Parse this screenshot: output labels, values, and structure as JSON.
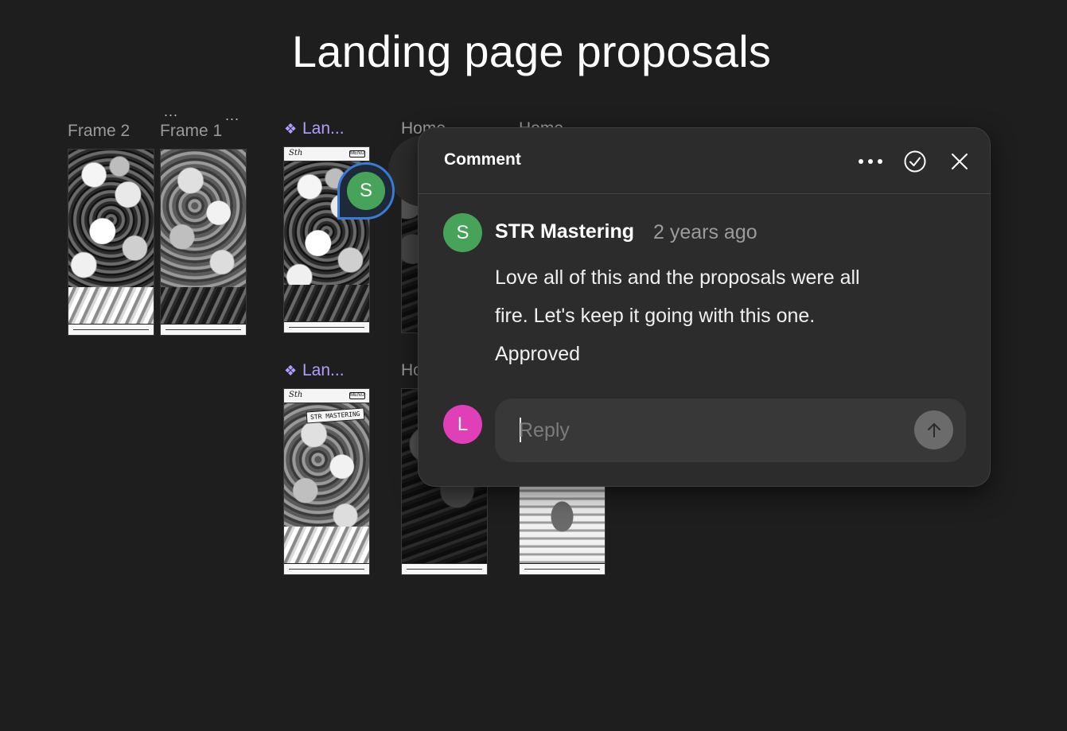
{
  "page": {
    "title": "Landing page proposals"
  },
  "frames": {
    "row1": [
      {
        "label": "Frame 2",
        "component": false
      },
      {
        "label": "Frame 1",
        "component": false
      },
      {
        "label": "Lan...",
        "component": true
      },
      {
        "label": "Home",
        "component": false
      },
      {
        "label": "Home",
        "component": false
      }
    ],
    "row2": [
      {
        "label": "Lan...",
        "component": true
      },
      {
        "label": "Ho",
        "component": false
      }
    ],
    "more_menu_glyph": "...",
    "thumb_logo": "Sth",
    "thumb_menu": "MENU",
    "thumb_tag": "STR MASTERING"
  },
  "pin": {
    "initial": "S",
    "color": "#48a35a"
  },
  "comment": {
    "header_title": "Comment",
    "author_initial": "S",
    "author_name": "STR Mastering",
    "time": "2 years ago",
    "body_lines": [
      "Love all of this and the proposals were all",
      "fire. Let's keep it going with this one.",
      "Approved"
    ],
    "reply": {
      "avatar_initial": "L",
      "avatar_color": "#e13fb8",
      "placeholder": "Reply",
      "value": ""
    },
    "icons": {
      "more": "more-horizontal-icon",
      "resolve": "check-circle-icon",
      "close": "close-icon",
      "send": "arrow-up-icon"
    }
  },
  "colors": {
    "canvas": "#1e1e1e",
    "panel": "#2c2c2c",
    "component_label": "#b39dff",
    "accent_blue": "#3a7bd5"
  }
}
